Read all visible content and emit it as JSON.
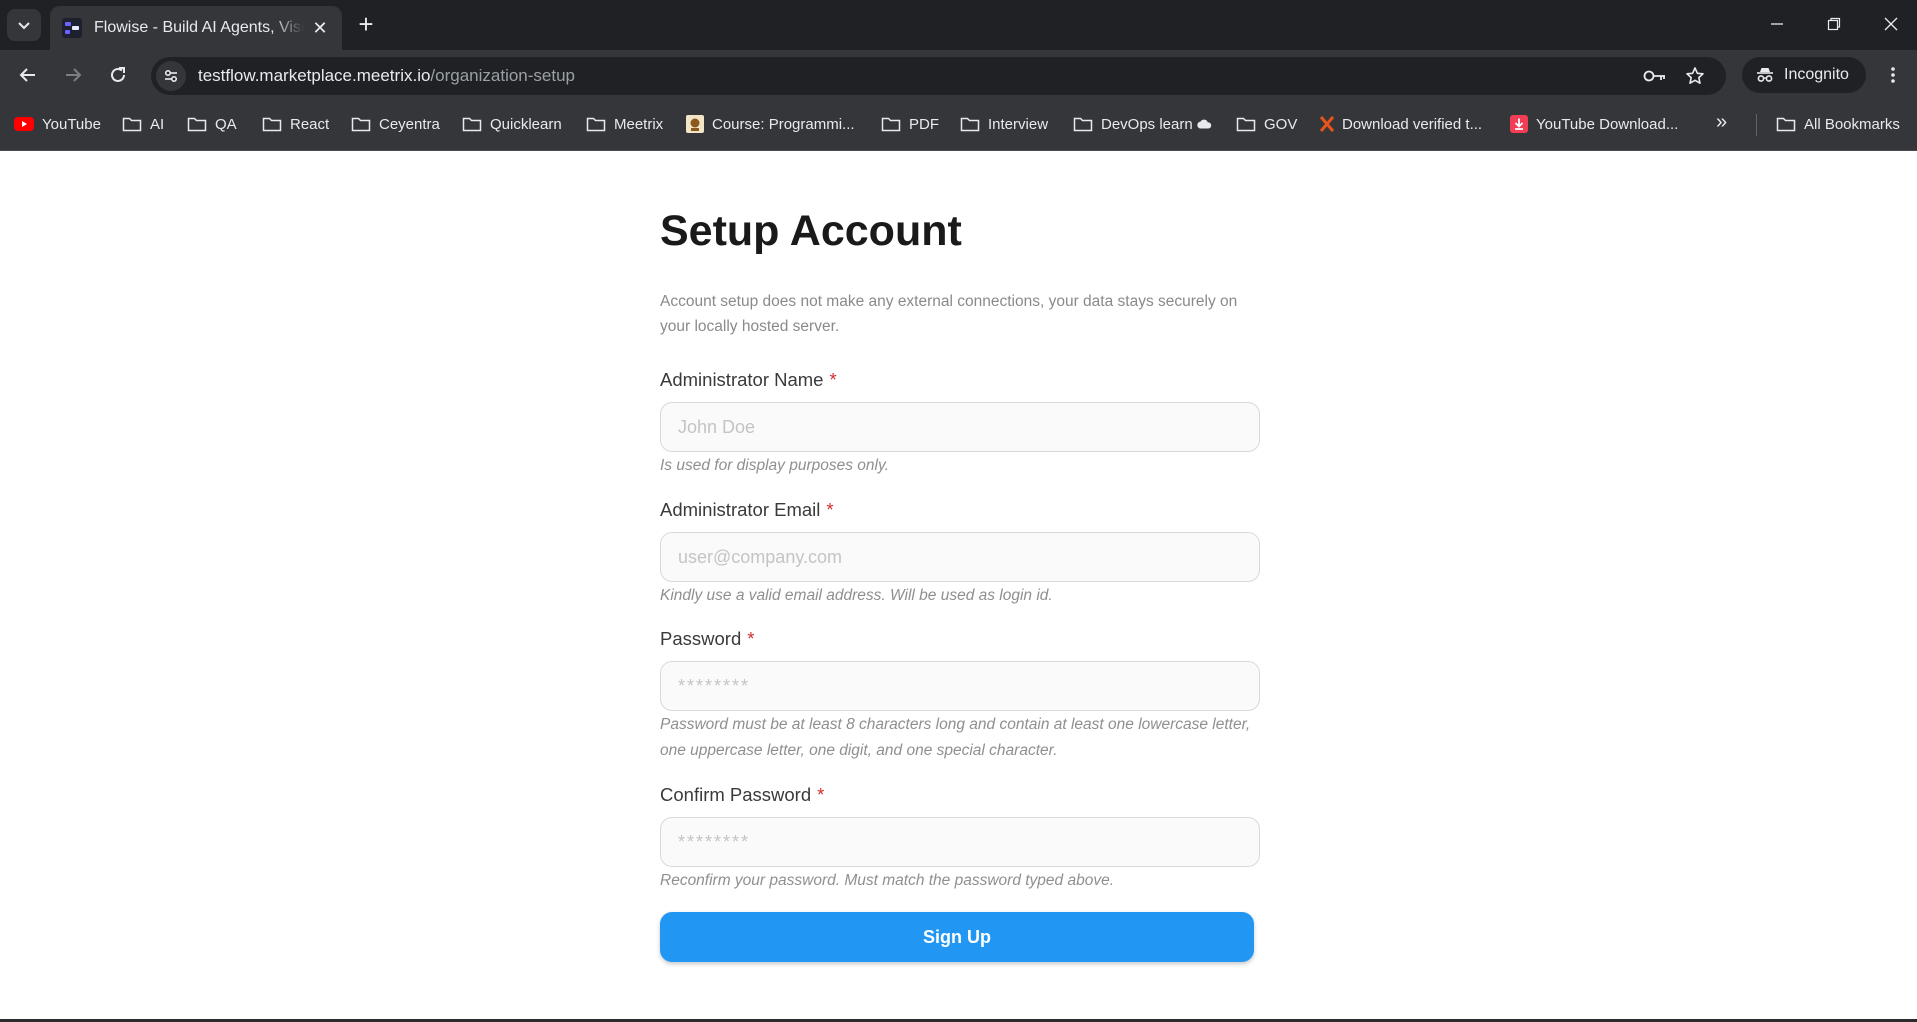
{
  "browser": {
    "tab": {
      "title": "Flowise - Build AI Agents, Visually"
    },
    "address": {
      "host": "testflow.marketplace.meetrix.io",
      "path": "/organization-setup"
    },
    "incognito_label": "Incognito",
    "bookmarks": [
      {
        "label": "YouTube",
        "icon": "youtube-icon"
      },
      {
        "label": "AI",
        "icon": "folder-icon"
      },
      {
        "label": "QA",
        "icon": "folder-icon"
      },
      {
        "label": "React",
        "icon": "folder-icon"
      },
      {
        "label": "Ceyentra",
        "icon": "folder-icon"
      },
      {
        "label": "Quicklearn",
        "icon": "folder-icon"
      },
      {
        "label": "Meetrix",
        "icon": "folder-icon"
      },
      {
        "label": "Course: Programmi...",
        "icon": "course-favicon-icon"
      },
      {
        "label": "PDF",
        "icon": "folder-icon"
      },
      {
        "label": "Interview",
        "icon": "folder-icon"
      },
      {
        "label": "DevOps learn",
        "icon": "folder-icon"
      },
      {
        "label": "GOV",
        "icon": "folder-icon"
      },
      {
        "label": "Download verified t...",
        "icon": "x-favicon-icon"
      },
      {
        "label": "YouTube Download...",
        "icon": "download-favicon-icon"
      }
    ],
    "all_bookmarks_label": "All Bookmarks"
  },
  "form": {
    "title": "Setup Account",
    "subtitle": "Account setup does not make any external connections, your data stays securely on your locally hosted server.",
    "required_marker": "*",
    "fields": {
      "name": {
        "label": "Administrator Name",
        "placeholder": "John Doe",
        "hint": "Is used for display purposes only."
      },
      "email": {
        "label": "Administrator Email",
        "placeholder": "user@company.com",
        "hint": "Kindly use a valid email address. Will be used as login id."
      },
      "password": {
        "label": "Password",
        "placeholder": "********",
        "hint": "Password must be at least 8 characters long and contain at least one lowercase letter, one uppercase letter, one digit, and one special character."
      },
      "confirm": {
        "label": "Confirm Password",
        "placeholder": "********",
        "hint": "Reconfirm your password. Must match the password typed above."
      }
    },
    "submit_label": "Sign Up"
  },
  "colors": {
    "primary": "#2196f3",
    "required": "#d32f2f",
    "chrome_dark": "#202124",
    "chrome_mid": "#35363a"
  }
}
